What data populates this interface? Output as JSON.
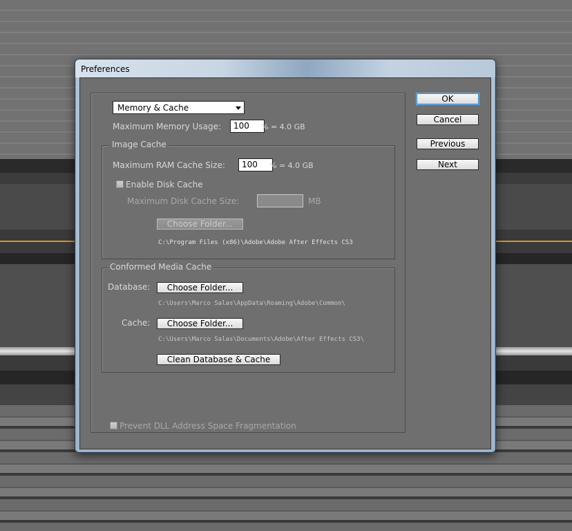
{
  "window": {
    "title": "Preferences"
  },
  "section": {
    "selected": "Memory & Cache"
  },
  "memory": {
    "max_usage_label": "Maximum Memory Usage:",
    "max_usage_value": "100",
    "max_usage_unit": "% = 4.0 GB"
  },
  "image_cache": {
    "title": "Image Cache",
    "ram_label": "Maximum RAM Cache Size:",
    "ram_value": "100",
    "ram_unit": "% = 4.0 GB",
    "enable_disk_label": "Enable Disk Cache",
    "disk_size_label": "Maximum Disk Cache Size:",
    "disk_size_unit": "MB",
    "choose_folder_label": "Choose Folder...",
    "path": "C:\\Program Files (x86)\\Adobe\\Adobe After Effects CS3"
  },
  "conformed": {
    "title": "Conformed Media Cache",
    "database_label": "Database:",
    "database_button": "Choose Folder...",
    "database_path": "C:\\Users\\Marco Salas\\AppData\\Roaming\\Adobe\\Common\\",
    "cache_label": "Cache:",
    "cache_button": "Choose Folder...",
    "cache_path": "C:\\Users\\Marco Salas\\Documents\\Adobe\\After Effects CS3\\",
    "clean_button": "Clean Database & Cache"
  },
  "prevent_dll_label": "Prevent DLL Address Space Fragmentation",
  "buttons": {
    "ok": "OK",
    "cancel": "Cancel",
    "previous": "Previous",
    "next": "Next"
  }
}
